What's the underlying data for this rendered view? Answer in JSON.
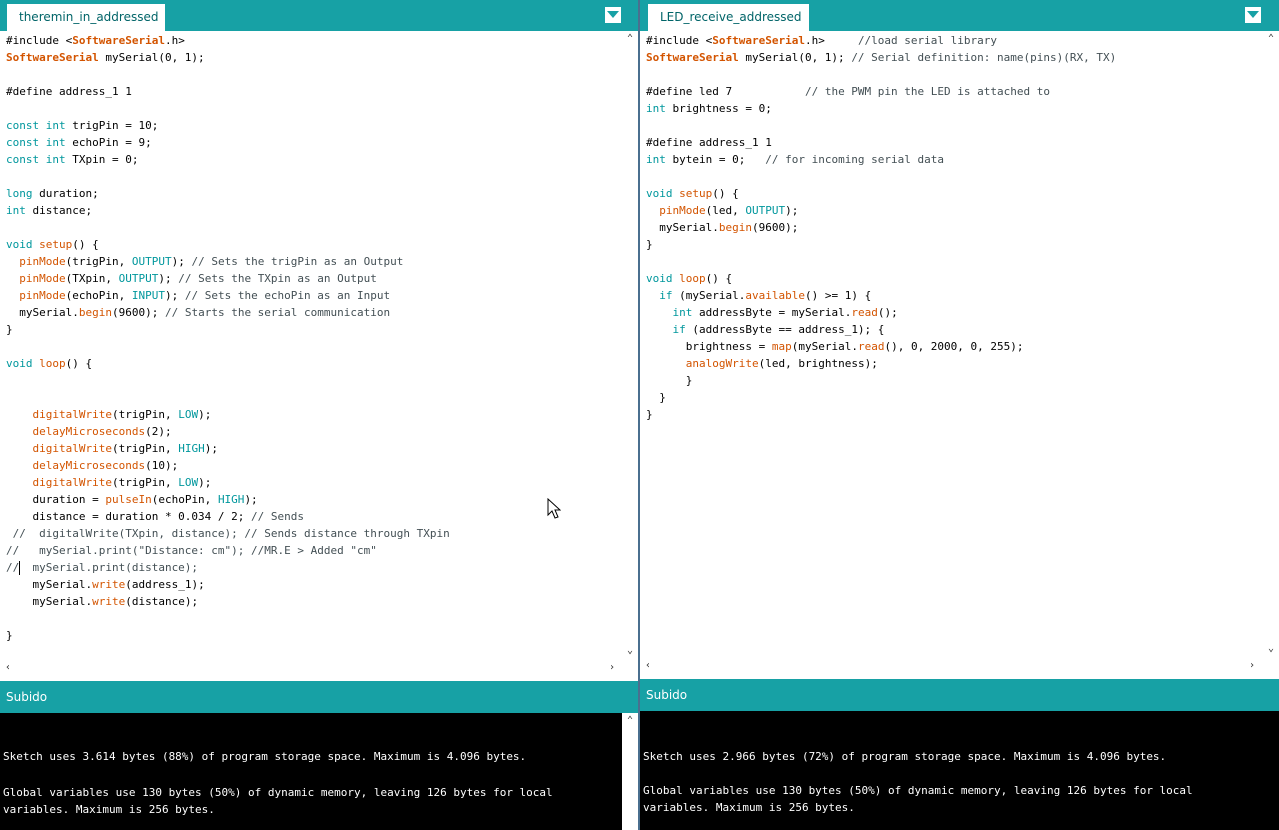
{
  "left": {
    "tab_label": "theremin_in_addressed",
    "status_text": "Subido",
    "console": [
      "Sketch uses 3.614 bytes (88%) of program storage space. Maximum is 4.096 bytes.",
      "Global variables use 130 bytes (50%) of dynamic memory, leaving 126 bytes for local",
      "variables. Maximum is 256 bytes."
    ]
  },
  "right": {
    "tab_label": "LED_receive_addressed",
    "status_text": "Subido",
    "console": [
      "Sketch uses 2.966 bytes (72%) of program storage space. Maximum is 4.096 bytes.",
      "Global variables use 130 bytes (50%) of dynamic memory, leaving 126 bytes for local",
      "variables. Maximum is 256 bytes."
    ]
  },
  "left_code": [
    [
      [
        "t",
        "#include <"
      ],
      [
        "cls",
        "SoftwareSerial"
      ],
      [
        "t",
        ".h>"
      ]
    ],
    [
      [
        "cls",
        "SoftwareSerial"
      ],
      [
        "t",
        " mySerial(0, 1);"
      ]
    ],
    [],
    [
      [
        "t",
        "#define address_1 1"
      ]
    ],
    [],
    [
      [
        "kw",
        "const"
      ],
      [
        "t",
        " "
      ],
      [
        "kw",
        "int"
      ],
      [
        "t",
        " trigPin = 10;"
      ]
    ],
    [
      [
        "kw",
        "const"
      ],
      [
        "t",
        " "
      ],
      [
        "kw",
        "int"
      ],
      [
        "t",
        " echoPin = 9;"
      ]
    ],
    [
      [
        "kw",
        "const"
      ],
      [
        "t",
        " "
      ],
      [
        "kw",
        "int"
      ],
      [
        "t",
        " TXpin = 0;"
      ]
    ],
    [],
    [
      [
        "kw",
        "long"
      ],
      [
        "t",
        " duration;"
      ]
    ],
    [
      [
        "kw",
        "int"
      ],
      [
        "t",
        " distance;"
      ]
    ],
    [],
    [
      [
        "kw",
        "void"
      ],
      [
        "t",
        " "
      ],
      [
        "fn",
        "setup"
      ],
      [
        "t",
        "() {"
      ]
    ],
    [
      [
        "t",
        "  "
      ],
      [
        "fn",
        "pinMode"
      ],
      [
        "t",
        "(trigPin, "
      ],
      [
        "cst",
        "OUTPUT"
      ],
      [
        "t",
        "); "
      ],
      [
        "cmt",
        "// Sets the trigPin as an Output"
      ]
    ],
    [
      [
        "t",
        "  "
      ],
      [
        "fn",
        "pinMode"
      ],
      [
        "t",
        "(TXpin, "
      ],
      [
        "cst",
        "OUTPUT"
      ],
      [
        "t",
        "); "
      ],
      [
        "cmt",
        "// Sets the TXpin as an Output"
      ]
    ],
    [
      [
        "t",
        "  "
      ],
      [
        "fn",
        "pinMode"
      ],
      [
        "t",
        "(echoPin, "
      ],
      [
        "cst",
        "INPUT"
      ],
      [
        "t",
        "); "
      ],
      [
        "cmt",
        "// Sets the echoPin as an Input"
      ]
    ],
    [
      [
        "t",
        "  mySerial."
      ],
      [
        "fn",
        "begin"
      ],
      [
        "t",
        "(9600); "
      ],
      [
        "cmt",
        "// Starts the serial communication"
      ]
    ],
    [
      [
        "t",
        "}"
      ]
    ],
    [],
    [
      [
        "kw",
        "void"
      ],
      [
        "t",
        " "
      ],
      [
        "fn",
        "loop"
      ],
      [
        "t",
        "() {"
      ]
    ],
    [],
    [],
    [
      [
        "t",
        "    "
      ],
      [
        "fn",
        "digitalWrite"
      ],
      [
        "t",
        "(trigPin, "
      ],
      [
        "cst",
        "LOW"
      ],
      [
        "t",
        ");"
      ]
    ],
    [
      [
        "t",
        "    "
      ],
      [
        "fn",
        "delayMicroseconds"
      ],
      [
        "t",
        "(2);"
      ]
    ],
    [
      [
        "t",
        "    "
      ],
      [
        "fn",
        "digitalWrite"
      ],
      [
        "t",
        "(trigPin, "
      ],
      [
        "cst",
        "HIGH"
      ],
      [
        "t",
        ");"
      ]
    ],
    [
      [
        "t",
        "    "
      ],
      [
        "fn",
        "delayMicroseconds"
      ],
      [
        "t",
        "(10);"
      ]
    ],
    [
      [
        "t",
        "    "
      ],
      [
        "fn",
        "digitalWrite"
      ],
      [
        "t",
        "(trigPin, "
      ],
      [
        "cst",
        "LOW"
      ],
      [
        "t",
        ");"
      ]
    ],
    [
      [
        "t",
        "    duration = "
      ],
      [
        "fn",
        "pulseIn"
      ],
      [
        "t",
        "(echoPin, "
      ],
      [
        "cst",
        "HIGH"
      ],
      [
        "t",
        ");"
      ]
    ],
    [
      [
        "t",
        "    distance = duration * 0.034 / 2; "
      ],
      [
        "cmt",
        "// Sends"
      ]
    ],
    [
      [
        "cmt",
        " //  digitalWrite(TXpin, distance); // Sends distance through TXpin"
      ]
    ],
    [
      [
        "cmt",
        "//   mySerial.print(\"Distance: cm\"); //MR.E > Added \"cm\""
      ]
    ],
    [
      [
        "cmt",
        "//  mySerial.print(distance);"
      ]
    ],
    [
      [
        "t",
        "    mySerial."
      ],
      [
        "fn",
        "write"
      ],
      [
        "t",
        "(address_1);"
      ]
    ],
    [
      [
        "t",
        "    mySerial."
      ],
      [
        "fn",
        "write"
      ],
      [
        "t",
        "(distance);"
      ]
    ],
    [],
    [
      [
        "t",
        "}"
      ]
    ]
  ],
  "right_code": [
    [
      [
        "t",
        "#include <"
      ],
      [
        "cls",
        "SoftwareSerial"
      ],
      [
        "t",
        ".h>     "
      ],
      [
        "cmt",
        "//load serial library"
      ]
    ],
    [
      [
        "cls",
        "SoftwareSerial"
      ],
      [
        "t",
        " mySerial(0, 1); "
      ],
      [
        "cmt",
        "// Serial definition: name(pins)(RX, TX)"
      ]
    ],
    [],
    [
      [
        "t",
        "#define led 7           "
      ],
      [
        "cmt",
        "// the PWM pin the LED is attached to"
      ]
    ],
    [
      [
        "kw",
        "int"
      ],
      [
        "t",
        " brightness = 0;"
      ]
    ],
    [],
    [
      [
        "t",
        "#define address_1 1"
      ]
    ],
    [
      [
        "kw",
        "int"
      ],
      [
        "t",
        " bytein = 0;   "
      ],
      [
        "cmt",
        "// for incoming serial data"
      ]
    ],
    [],
    [
      [
        "kw",
        "void"
      ],
      [
        "t",
        " "
      ],
      [
        "fn",
        "setup"
      ],
      [
        "t",
        "() {"
      ]
    ],
    [
      [
        "t",
        "  "
      ],
      [
        "fn",
        "pinMode"
      ],
      [
        "t",
        "(led, "
      ],
      [
        "cst",
        "OUTPUT"
      ],
      [
        "t",
        ");"
      ]
    ],
    [
      [
        "t",
        "  mySerial."
      ],
      [
        "fn",
        "begin"
      ],
      [
        "t",
        "(9600);"
      ]
    ],
    [
      [
        "t",
        "}"
      ]
    ],
    [],
    [
      [
        "kw",
        "void"
      ],
      [
        "t",
        " "
      ],
      [
        "fn",
        "loop"
      ],
      [
        "t",
        "() {"
      ]
    ],
    [
      [
        "t",
        "  "
      ],
      [
        "kw",
        "if"
      ],
      [
        "t",
        " (mySerial."
      ],
      [
        "fn",
        "available"
      ],
      [
        "t",
        "() >= 1) {"
      ]
    ],
    [
      [
        "t",
        "    "
      ],
      [
        "kw",
        "int"
      ],
      [
        "t",
        " addressByte = mySerial."
      ],
      [
        "fn",
        "read"
      ],
      [
        "t",
        "();"
      ]
    ],
    [
      [
        "t",
        "    "
      ],
      [
        "kw",
        "if"
      ],
      [
        "t",
        " (addressByte == address_1); {"
      ]
    ],
    [
      [
        "t",
        "      brightness = "
      ],
      [
        "fn",
        "map"
      ],
      [
        "t",
        "(mySerial."
      ],
      [
        "fn",
        "read"
      ],
      [
        "t",
        "(), 0, 2000, 0, 255);"
      ]
    ],
    [
      [
        "t",
        "      "
      ],
      [
        "fn",
        "analogWrite"
      ],
      [
        "t",
        "(led, brightness);"
      ]
    ],
    [
      [
        "t",
        "      }"
      ]
    ],
    [
      [
        "t",
        "  }"
      ]
    ],
    [
      [
        "t",
        "}"
      ]
    ]
  ]
}
